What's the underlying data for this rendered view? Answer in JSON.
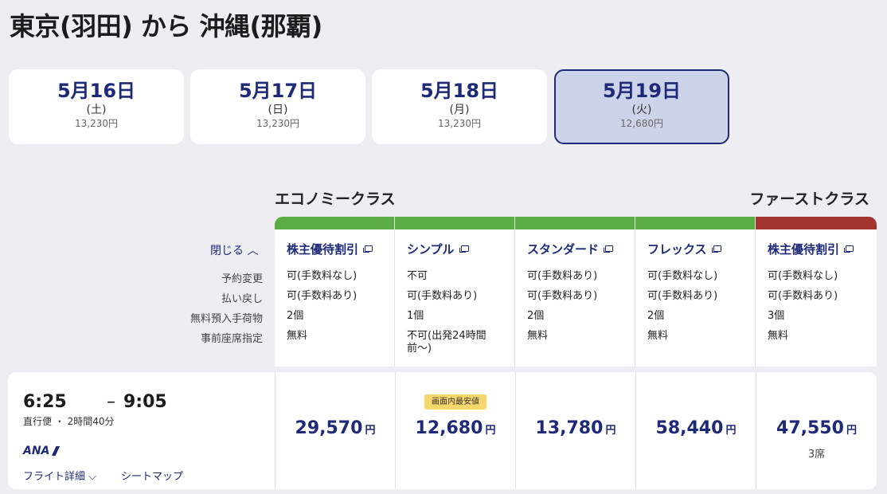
{
  "title": "東京(羽田) から 沖縄(那覇)",
  "dates": [
    {
      "date": "5月16日",
      "weekday": "(土)",
      "price": "13,230円"
    },
    {
      "date": "5月17日",
      "weekday": "(日)",
      "price": "13,230円"
    },
    {
      "date": "5月18日",
      "weekday": "(月)",
      "price": "13,230円"
    },
    {
      "date": "5月19日",
      "weekday": "(火)",
      "price": "12,680円",
      "selected": true
    }
  ],
  "class_headers": {
    "economy": "エコノミークラス",
    "first": "ファーストクラス"
  },
  "colors": {
    "economy_bar": "#5aac44",
    "first_bar": "#a23530",
    "brand": "#1e2a78",
    "badge": "#f6d76b"
  },
  "close_toggle": "閉じる ︿",
  "row_labels": [
    "予約変更",
    "払い戻し",
    "無料預入手荷物",
    "事前座席指定"
  ],
  "fares": [
    {
      "name": "株主優待割引",
      "icon": "external-link-icon",
      "change": "可(手数料なし)",
      "refund": "可(手数料あり)",
      "baggage": "2個",
      "seat": "無料"
    },
    {
      "name": "シンプル",
      "icon": "external-link-icon",
      "change": "不可",
      "refund": "可(手数料あり)",
      "baggage": "1個",
      "seat": "不可(出発24時間前〜)"
    },
    {
      "name": "スタンダード",
      "icon": "external-link-icon",
      "change": "可(手数料あり)",
      "refund": "可(手数料あり)",
      "baggage": "2個",
      "seat": "無料"
    },
    {
      "name": "フレックス",
      "icon": "external-link-icon",
      "change": "可(手数料なし)",
      "refund": "可(手数料あり)",
      "baggage": "2個",
      "seat": "無料"
    },
    {
      "name": "株主優待割引",
      "icon": "external-link-icon",
      "change": "可(手数料なし)",
      "refund": "可(手数料あり)",
      "baggage": "3個",
      "seat": "無料"
    }
  ],
  "flight": {
    "depart": "6:25",
    "dash": "–",
    "arrive": "9:05",
    "info": "直行便 ・ 2時間40分",
    "airline": "ANA",
    "detail_link": "フライト詳細 ⌵",
    "seatmap_link": "シートマップ",
    "prices": [
      {
        "amount": "29,570",
        "yen": "円"
      },
      {
        "amount": "12,680",
        "yen": "円",
        "badge": "画面内最安値"
      },
      {
        "amount": "13,780",
        "yen": "円"
      },
      {
        "amount": "58,440",
        "yen": "円"
      },
      {
        "amount": "47,550",
        "yen": "円",
        "seats": "3席"
      }
    ]
  }
}
